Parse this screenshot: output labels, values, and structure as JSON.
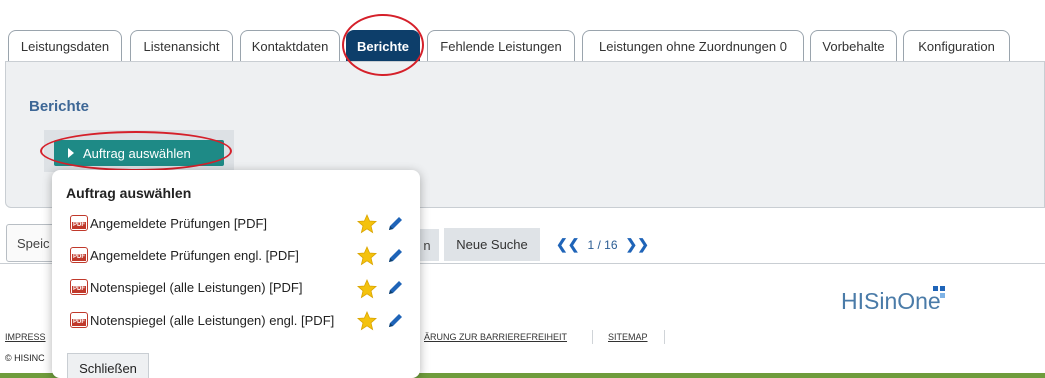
{
  "tabs": [
    {
      "label": "Leistungsdaten",
      "active": false
    },
    {
      "label": "Listenansicht",
      "active": false
    },
    {
      "label": "Kontaktdaten",
      "active": false
    },
    {
      "label": "Berichte",
      "active": true
    },
    {
      "label": "Fehlende Leistungen",
      "active": false
    },
    {
      "label": "Leistungen ohne Zuordnungen 0",
      "active": false
    },
    {
      "label": "Vorbehalte",
      "active": false
    },
    {
      "label": "Konfiguration",
      "active": false
    }
  ],
  "panel": {
    "title": "Berichte",
    "button_label": "Auftrag auswählen"
  },
  "toolbar": {
    "speic_label": "Speic",
    "partial_button_label": "n",
    "new_search_label": "Neue Suche",
    "pager_text": "1 / 16",
    "pager_prev_icon": "double-chevron-left-icon",
    "pager_next_icon": "double-chevron-right-icon"
  },
  "logo": {
    "text": "HISinOne",
    "square_colors": [
      "#1f64b8",
      "#1f64b8",
      "#7fb3e6"
    ]
  },
  "footer": {
    "impress": "IMPRESS",
    "barriere": "ÄRUNG ZUR BARRIEREFREIHEIT",
    "sitemap": "SITEMAP",
    "copyright": "© HISINC"
  },
  "popup": {
    "title": "Auftrag auswählen",
    "items": [
      {
        "label": "Angemeldete Prüfungen  [PDF]"
      },
      {
        "label": "Angemeldete Prüfungen engl.  [PDF]"
      },
      {
        "label": "Notenspiegel (alle Leistungen)  [PDF]"
      },
      {
        "label": "Notenspiegel (alle Leistungen) engl.  [PDF]"
      }
    ],
    "close_label": "Schließen"
  },
  "colors": {
    "active_tab": "#0d3e6a",
    "accent_green": "#1e8a86",
    "annotation_red": "#d5202a",
    "title_blue": "#3d6796",
    "footer_line": "#6f9c3c"
  }
}
